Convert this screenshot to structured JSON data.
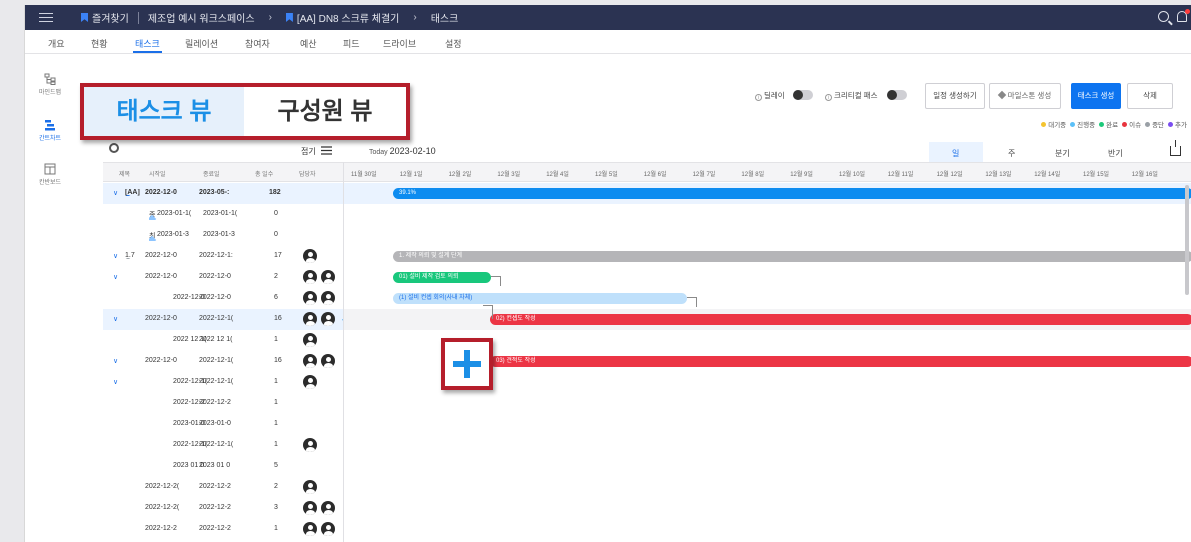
{
  "topbar": {
    "bookmark_label": "즐겨찾기",
    "workspace": "제조업 예시 워크스페이스",
    "project": "[AA] DN8 스크류 체결기",
    "page": "태스크"
  },
  "tabs": [
    "개요",
    "현황",
    "태스크",
    "릴레이션",
    "참여자",
    "예산",
    "피드",
    "드라이브",
    "설정"
  ],
  "active_tab": "태스크",
  "rail": [
    {
      "label": "마인드맵",
      "icon": "mindmap-icon"
    },
    {
      "label": "간트차트",
      "icon": "gantt-icon",
      "active": true
    },
    {
      "label": "칸반보드",
      "icon": "kanban-icon"
    }
  ],
  "toolbar": {
    "delay_label": "딜레이",
    "critical_label": "크리티컬 패스",
    "schedule_btn": "일정 생성하기",
    "milestone_btn": "마일스톤 생성",
    "task_btn": "태스크 생성",
    "delete_btn": "삭제"
  },
  "legend": [
    {
      "label": "대기중",
      "color": "#f4c430"
    },
    {
      "label": "진행중",
      "color": "#5bc0f8"
    },
    {
      "label": "완료",
      "color": "#1cc97a"
    },
    {
      "label": "이슈",
      "color": "#e8343e"
    },
    {
      "label": "중단",
      "color": "#9aa0a6"
    },
    {
      "label": "추가",
      "color": "#7a4df0"
    }
  ],
  "view_switch": {
    "task_view": "태스크 뷰",
    "member_view": "구성원 뷰"
  },
  "grid": {
    "collapse_label": "접기",
    "columns": [
      "제목",
      "시작일",
      "종료일",
      "총 일수",
      "담당자"
    ]
  },
  "timeline": {
    "today_label": "Today",
    "today_date": "2023-02-10",
    "scales": [
      "일",
      "주",
      "분기",
      "반기"
    ],
    "active_scale": "일",
    "days": [
      "11월 30일",
      "12월 1일",
      "12월 2일",
      "12월 3일",
      "12월 4일",
      "12월 5일",
      "12월 6일",
      "12월 7일",
      "12월 8일",
      "12월 9일",
      "12월 10일",
      "12월 11일",
      "12월 12일",
      "12월 13일",
      "12월 14일",
      "12월 15일",
      "12월 16일"
    ]
  },
  "rows": [
    {
      "title": "[AA]",
      "start": "2022-12-0",
      "end": "2023-05-:",
      "days": "182",
      "avatars": 0,
      "status_color": "#1b6fe8",
      "caret": "∨",
      "bold": true,
      "hl": true
    },
    {
      "title": "종",
      "start": "2023-01-1(",
      "end": "2023-01-1(",
      "days": "0",
      "avatars": 0,
      "diamond": true
    },
    {
      "title": "최",
      "start": "2023-01-3",
      "end": "2023-01-3",
      "days": "0",
      "avatars": 0,
      "diamond": true
    },
    {
      "title": "1.7",
      "start": "2022-12-0",
      "end": "2022-12-1:",
      "days": "17",
      "avatars": 1,
      "status_color": "#9aa0a6",
      "caret": "∨"
    },
    {
      "title": "",
      "start": "2022-12-0",
      "end": "2022-12-0",
      "days": "2",
      "avatars": 2,
      "status_color": "#1cc97a",
      "caret": "∨"
    },
    {
      "title": "",
      "start": "2022-12-0",
      "end": "2022-12-0",
      "days": "6",
      "avatars": 2
    },
    {
      "title": "",
      "start": "2022-12-0",
      "end": "2022-12-1(",
      "days": "16",
      "avatars": 2,
      "status_color": "#e8343e",
      "caret": "∨",
      "plus": true,
      "hl": true
    },
    {
      "title": "",
      "start": "2022 12 1(",
      "end": "2022 12 1(",
      "days": "1",
      "avatars": 1
    },
    {
      "title": "",
      "start": "2022-12-0",
      "end": "2022-12-1(",
      "days": "16",
      "avatars": 2,
      "status_color": "#e8343e",
      "caret": "∨"
    },
    {
      "title": "",
      "start": "2022-12-1(",
      "end": "2022-12-1(",
      "days": "1",
      "avatars": 1,
      "caret": "∨"
    },
    {
      "title": "",
      "start": "2022-12-2",
      "end": "2022-12-2",
      "days": "1",
      "avatars": 0
    },
    {
      "title": "",
      "start": "2023-01-0",
      "end": "2023-01-0",
      "days": "1",
      "avatars": 0
    },
    {
      "title": "",
      "start": "2022-12-1(",
      "end": "2022-12-1(",
      "days": "1",
      "avatars": 1
    },
    {
      "title": "",
      "start": "2023 01 0",
      "end": "2023 01 0",
      "days": "5",
      "avatars": 0
    },
    {
      "title": "",
      "start": "2022-12-2(",
      "end": "2022-12-2",
      "days": "2",
      "avatars": 1,
      "status_color": "#1cc97a"
    },
    {
      "title": "",
      "start": "2022-12-2(",
      "end": "2022-12-2",
      "days": "3",
      "avatars": 2,
      "status_color": "#1cc97a"
    },
    {
      "title": "",
      "start": "2022-12-2",
      "end": "2022-12-2",
      "days": "1",
      "avatars": 2,
      "status_color": "#1cc97a"
    }
  ],
  "bars": [
    {
      "label": "39.1%",
      "color": "#0d8cf0"
    },
    {
      "label": "1. 제작 의뢰 및 설계 단계",
      "color": "#b5b5b8"
    },
    {
      "label": "01) 설비 제작 검토 의뢰",
      "color": "#18c77c"
    },
    {
      "label": "(1) 설비 컨셉 회의(사내 자체)",
      "color": "#bfe0fb"
    },
    {
      "label": "02) 컨셉도 작성",
      "color": "#ec3545"
    },
    {
      "label": "03) 견적도 작성",
      "color": "#ec3545"
    }
  ]
}
